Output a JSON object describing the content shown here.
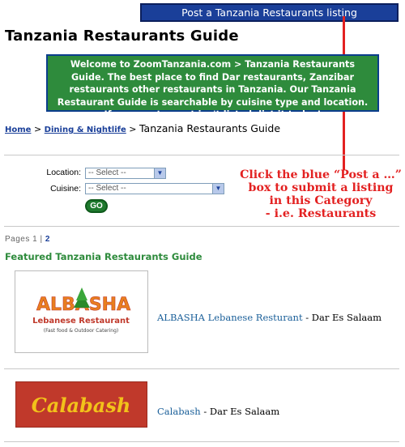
{
  "header": {
    "post_button_label": "Post a Tanzania Restaurants listing",
    "page_title": "Tanzania Restaurants Guide"
  },
  "welcome": {
    "text": "Welcome to ZoomTanzania.com > Tanzania Restaurants Guide.  The best place to find Dar restaurants, Zanzibar restaurants other restaurants in Tanzania. Our Tanzania Restaurant Guide is searchable by cuisine type and location.  If your restaurant isn't listed, list it today!"
  },
  "breadcrumb": {
    "home": "Home",
    "sep1": " > ",
    "dining": "Dining & Nightlife",
    "sep2": " > ",
    "current": "Tanzania Restaurants Guide"
  },
  "search": {
    "location_label": "Location:",
    "location_value": "-- Select --",
    "cuisine_label": "Cuisine:",
    "cuisine_value": "-- Select --",
    "go_label": "GO"
  },
  "annotation": {
    "line1": "Click the blue “Post a …”",
    "line2": "box to submit a listing",
    "line3": "in this Category",
    "line4": "- i.e. Restaurants"
  },
  "pagination": {
    "label": "Pages 1 |",
    "page2": "2"
  },
  "featured_heading": "Featured Tanzania Restaurants Guide",
  "listings": [
    {
      "name": "ALBASHA Lebanese Resturant",
      "location": " - Dar Es Salaam",
      "logo_title": "ALBASHA",
      "logo_subtitle": "Lebanese Restaurant",
      "logo_tagline": "(Fast food & Outdoor Catering)"
    },
    {
      "name": "Calabash",
      "location": " - Dar Es Salaam",
      "logo_title": "Calabash"
    }
  ],
  "colors": {
    "post_button": "#1a3f99",
    "welcome_bg": "#2e8b3c",
    "annotation": "#e32121",
    "link": "#1a3f99"
  }
}
